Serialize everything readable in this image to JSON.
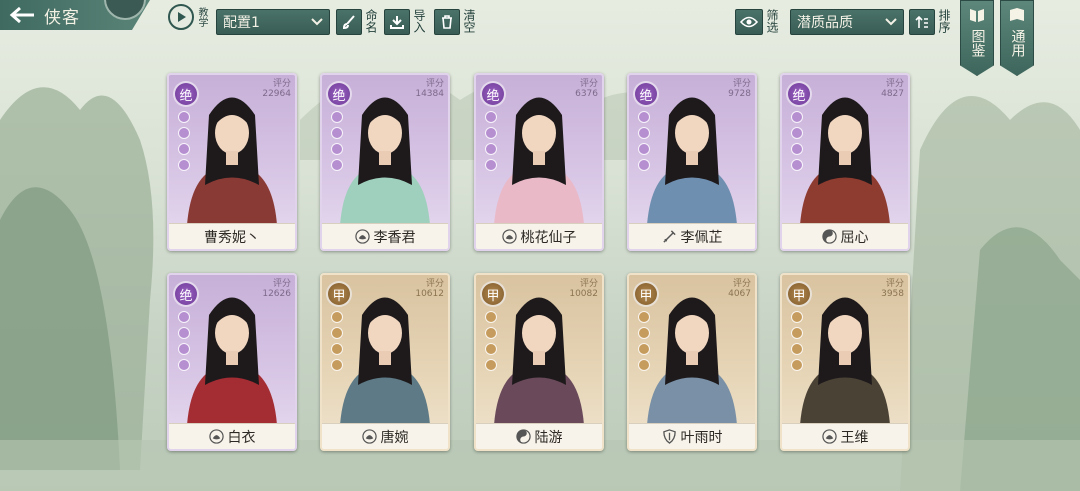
{
  "header": {
    "title": "侠客",
    "tutorial_label": "教学",
    "config_select": "配置1",
    "rename_label": "命名",
    "import_label": "导入",
    "clear_label": "清空",
    "filter_label": "筛选",
    "sort_select": "潜质品质",
    "order_label": "排序",
    "codex_label": "图鉴",
    "general_label": "通用"
  },
  "score_label": "评分",
  "cards": [
    {
      "name": "曹秀妮丶",
      "rank": "绝",
      "score": "22964",
      "tier": "jue",
      "icon": "none-icon"
    },
    {
      "name": "李香君",
      "rank": "绝",
      "score": "14384",
      "tier": "jue",
      "icon": "lotus-icon"
    },
    {
      "name": "桃花仙子",
      "rank": "绝",
      "score": "6376",
      "tier": "jue",
      "icon": "lotus-icon"
    },
    {
      "name": "李佩芷",
      "rank": "绝",
      "score": "9728",
      "tier": "jue",
      "icon": "sword-icon"
    },
    {
      "name": "屈心",
      "rank": "绝",
      "score": "4827",
      "tier": "jue",
      "icon": "taiji-icon"
    },
    {
      "name": "白衣",
      "rank": "绝",
      "score": "12626",
      "tier": "jue",
      "icon": "lotus-icon"
    },
    {
      "name": "唐婉",
      "rank": "甲",
      "score": "10612",
      "tier": "jia",
      "icon": "lotus-icon"
    },
    {
      "name": "陆游",
      "rank": "甲",
      "score": "10082",
      "tier": "jia",
      "icon": "taiji-icon"
    },
    {
      "name": "叶雨时",
      "rank": "甲",
      "score": "4067",
      "tier": "jia",
      "icon": "shield-icon"
    },
    {
      "name": "王维",
      "rank": "甲",
      "score": "3958",
      "tier": "jia",
      "icon": "lotus-icon"
    }
  ],
  "colors": {
    "jue": "#8e5ab8",
    "jia": "#a67c40",
    "ui_green": "#3f6a60"
  }
}
